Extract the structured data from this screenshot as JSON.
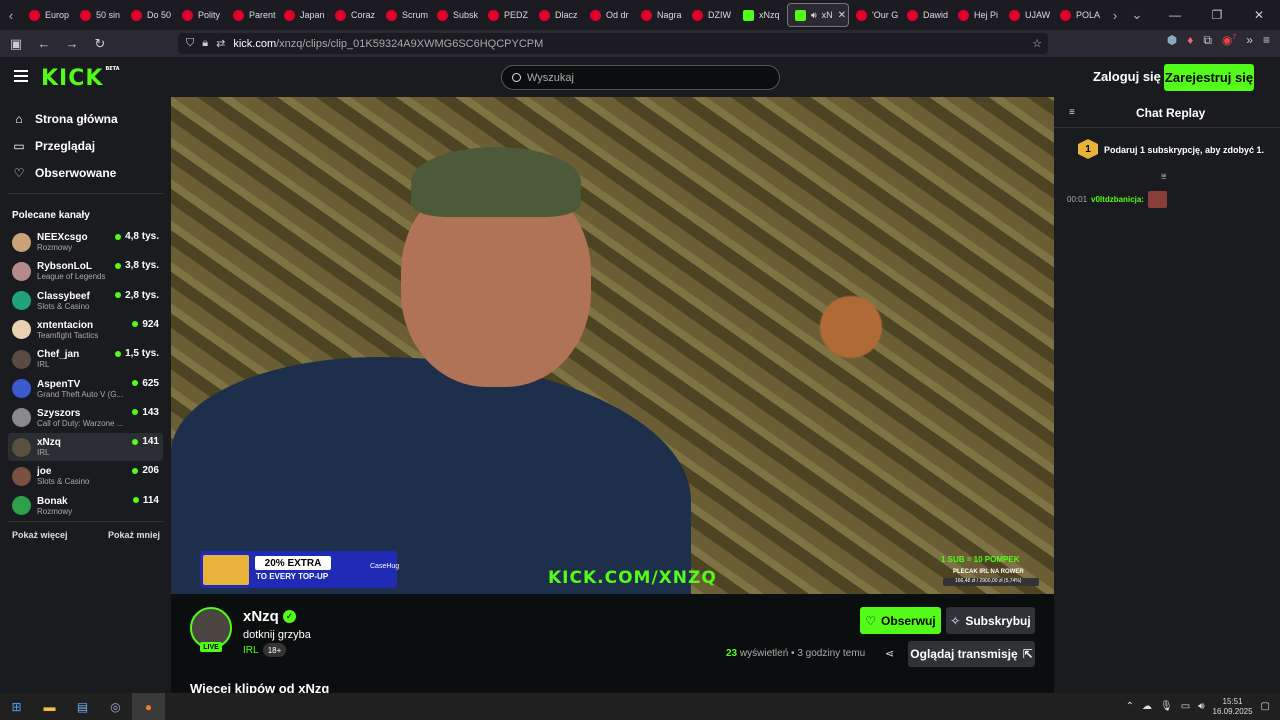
{
  "browser": {
    "tabs": [
      {
        "label": "Europ",
        "fav": "yt"
      },
      {
        "label": "50 sin",
        "fav": "yt"
      },
      {
        "label": "Do 50",
        "fav": "yt"
      },
      {
        "label": "Polity",
        "fav": "yt"
      },
      {
        "label": "Parent",
        "fav": "yt"
      },
      {
        "label": "Japan",
        "fav": "yt"
      },
      {
        "label": "Coraz",
        "fav": "yt"
      },
      {
        "label": "Scrum",
        "fav": "yt"
      },
      {
        "label": "Subsk",
        "fav": "yt"
      },
      {
        "label": "PEDZ",
        "fav": "yt"
      },
      {
        "label": "Dlacz",
        "fav": "yt"
      },
      {
        "label": "Od dr",
        "fav": "yt"
      },
      {
        "label": "Nagra",
        "fav": "yt"
      },
      {
        "label": "DZIW",
        "fav": "yt"
      },
      {
        "label": "xNzq",
        "fav": "kick"
      },
      {
        "label": "xN",
        "fav": "kick",
        "active": true
      },
      {
        "label": "'Our G",
        "fav": "yt"
      },
      {
        "label": "Dawid",
        "fav": "yt"
      },
      {
        "label": "Hej Pi",
        "fav": "yt"
      },
      {
        "label": "UJAW",
        "fav": "yt"
      },
      {
        "label": "POLA",
        "fav": "yt"
      }
    ],
    "url_host": "kick.com",
    "url_path": "/xnzq/clips/clip_01K59324A9XWMG6SC6HQCPYCPM",
    "extension_badge": "7"
  },
  "header": {
    "logo": "KICK",
    "logo_badge": "BETA",
    "search_placeholder": "Wyszukaj",
    "login_label": "Zaloguj się",
    "register_label": "Zarejestruj się"
  },
  "sidebar": {
    "nav": [
      {
        "label": "Strona główna",
        "icon": "home-icon"
      },
      {
        "label": "Przeglądaj",
        "icon": "browse-icon"
      },
      {
        "label": "Obserwowane",
        "icon": "heart-icon"
      }
    ],
    "section_title": "Polecane kanały",
    "channels": [
      {
        "name": "NEEXcsgo",
        "category": "Rozmowy",
        "viewers": "4,8 tys.",
        "color": "#c9a27a"
      },
      {
        "name": "RybsonLoL",
        "category": "League of Legends",
        "viewers": "3,8 tys.",
        "color": "#b58a8a"
      },
      {
        "name": "Classybeef",
        "category": "Slots & Casino",
        "viewers": "2,8 tys.",
        "color": "#1fa37a"
      },
      {
        "name": "xntentacion",
        "category": "Teamfight Tactics",
        "viewers": "924",
        "color": "#e8d0b0"
      },
      {
        "name": "Chef_jan",
        "category": "IRL",
        "viewers": "1,5 tys.",
        "color": "#5a4a44"
      },
      {
        "name": "AspenTV",
        "category": "Grand Theft Auto V (G...",
        "viewers": "625",
        "color": "#3b5ad0"
      },
      {
        "name": "Szyszors",
        "category": "Call of Duty: Warzone ...",
        "viewers": "143",
        "color": "#8a8a8a"
      },
      {
        "name": "xNzq",
        "category": "IRL",
        "viewers": "141",
        "color": "#5a5040",
        "active": true
      },
      {
        "name": "joe",
        "category": "Slots & Casino",
        "viewers": "206",
        "color": "#7a5040"
      },
      {
        "name": "Bonak",
        "category": "Rozmowy",
        "viewers": "114",
        "color": "#2fa04a"
      }
    ],
    "show_more": "Pokaż więcej",
    "show_less": "Pokaż mniej"
  },
  "video": {
    "ad_line1": "20% EXTRA",
    "ad_line2": "TO EVERY TOP-UP",
    "ad_brand": "CaseHug",
    "overlay_url": "KICK.COM/XNZQ",
    "overlay_sub": "1 SUB = 10 POMPEK",
    "overlay_goal": "PLECAK IRL NA ROWER",
    "overlay_bar": "166,48 zł / 2900,00 zł (5,74%)"
  },
  "clip": {
    "streamer": "xNzq",
    "live_label": "LIVE",
    "title": "dotknij grzyba",
    "category": "IRL",
    "age": "18+",
    "follow_label": "Obserwuj",
    "subscribe_label": "Subskrybuj",
    "views_count": "23",
    "views_label": "wyświetleń",
    "time_ago": "3 godziny temu",
    "watch_label": "Oglądaj transmisję",
    "more_clips": "Więcej klipów od xNzq"
  },
  "chat": {
    "title": "Chat Replay",
    "gift_number": "1",
    "gift_text": "Podaruj 1 subskrypcję, aby zdobyć 1.",
    "messages": [
      {
        "time": "00:01",
        "user": "v0ltdzbanicja:"
      }
    ]
  },
  "taskbar": {
    "time": "15:51",
    "date": "16.09.2025"
  }
}
